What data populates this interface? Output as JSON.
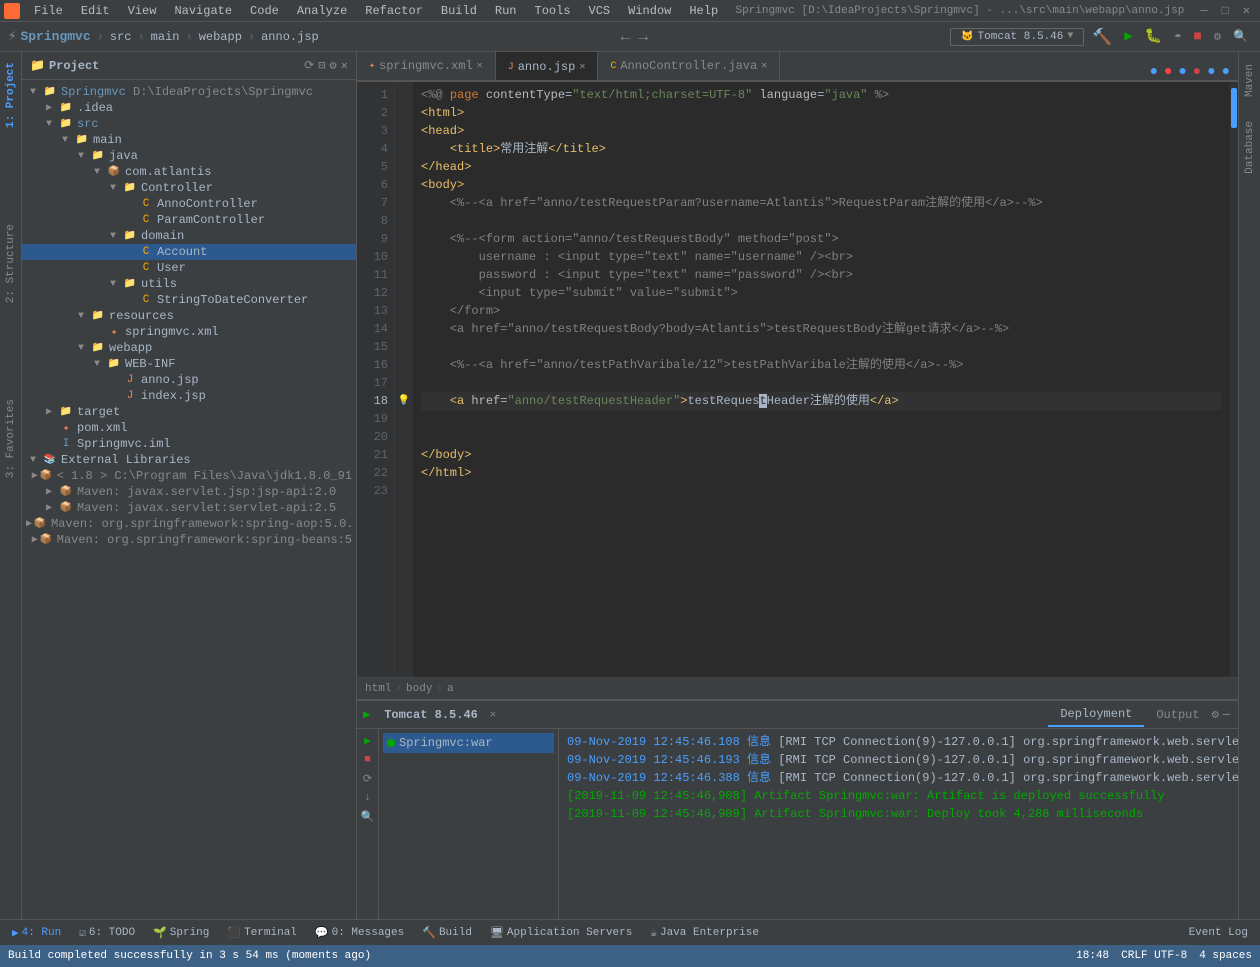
{
  "menubar": {
    "items": [
      "File",
      "Edit",
      "View",
      "Navigate",
      "Code",
      "Analyze",
      "Refactor",
      "Build",
      "Run",
      "Tools",
      "VCS",
      "Window",
      "Help"
    ]
  },
  "toolbar": {
    "project_name": "Springmvc",
    "path_parts": [
      "src",
      "main",
      "webapp",
      "anno.jsp"
    ],
    "run_config": "Tomcat 8.5.46"
  },
  "project_panel": {
    "title": "Project",
    "root": "Springmvc",
    "root_path": "D:\\IdeaProjects\\Springmvc"
  },
  "tabs": [
    {
      "label": "springmvc.xml",
      "active": false
    },
    {
      "label": "anno.jsp",
      "active": true
    },
    {
      "label": "AnnoController.java",
      "active": false
    }
  ],
  "code_lines": [
    {
      "num": 1,
      "content": "<%@ page contentType=\"text/html;charset=UTF-8\" language=\"java\" %>"
    },
    {
      "num": 2,
      "content": "<html>"
    },
    {
      "num": 3,
      "content": "<head>"
    },
    {
      "num": 4,
      "content": "    <title>常用注解</title>"
    },
    {
      "num": 5,
      "content": "</head>"
    },
    {
      "num": 6,
      "content": "<body>"
    },
    {
      "num": 7,
      "content": "    <%--<a href=\"anno/testRequestParam?username=Atlantis\">RequestParam注解的使用</a>--%>"
    },
    {
      "num": 8,
      "content": ""
    },
    {
      "num": 9,
      "content": "    <%--<form action=\"anno/testRequestBody\" method=\"post\">"
    },
    {
      "num": 10,
      "content": "        username : <input type=\"text\" name=\"username\" /><br>"
    },
    {
      "num": 11,
      "content": "        password : <input type=\"text\" name=\"password\" /><br>"
    },
    {
      "num": 12,
      "content": "        <input type=\"submit\" value=\"submit\">"
    },
    {
      "num": 13,
      "content": "    </form>"
    },
    {
      "num": 14,
      "content": "    <a href=\"anno/testRequestBody?body=Atlantis\">testRequestBody注解get请求</a>--%>"
    },
    {
      "num": 15,
      "content": ""
    },
    {
      "num": 16,
      "content": "    <%--<a href=\"anno/testPathVaribale/12\">testPathVaribale注解的使用</a>--%>"
    },
    {
      "num": 17,
      "content": ""
    },
    {
      "num": 18,
      "content": "    <a href=\"anno/testRequestHeader\">testRequestHeader注解的使用</a>"
    },
    {
      "num": 19,
      "content": ""
    },
    {
      "num": 20,
      "content": ""
    },
    {
      "num": 21,
      "content": "</body>"
    },
    {
      "num": 22,
      "content": "</html>"
    },
    {
      "num": 23,
      "content": ""
    }
  ],
  "breadcrumb": {
    "items": [
      "html",
      "body",
      "a"
    ]
  },
  "bottom_panel": {
    "title": "Tomcat 8.5.46",
    "tabs": [
      {
        "label": "Deployment",
        "active": true
      },
      {
        "label": "Output",
        "active": false
      }
    ],
    "server": "Springmvc:war",
    "log_lines": [
      {
        "text": "09-Nov-2019 12:45:46.108 信息 [RMI TCP Connection(9)-127.0.0.1] org.springframework.web.servlet.mvc.method.anno",
        "type": "info"
      },
      {
        "text": "09-Nov-2019 12:45:46.193 信息 [RMI TCP Connection(9)-127.0.0.1] org.springframework.web.servlet.mvc.method.anno",
        "type": "info"
      },
      {
        "text": "09-Nov-2019 12:45:46.388 信息 [RMI TCP Connection(9)-127.0.0.1] org.springframework.web.servlet.FrameworkServle",
        "type": "info"
      },
      {
        "text": "[2019-11-09 12:45:46,908] Artifact Springmvc:war: Artifact is deployed successfully",
        "type": "success"
      },
      {
        "text": "[2019-11-09 12:45:46,909] Artifact Springmvc:war: Deploy took 4,288 milliseconds",
        "type": "success"
      }
    ]
  },
  "statusbar": {
    "left": "Build completed successfully in 3 s 54 ms (moments ago)",
    "line_col": "18:48",
    "encoding": "CRLF  UTF-8",
    "indent": "4 spaces"
  },
  "bottom_tools": [
    {
      "label": "4: Run",
      "active": true,
      "icon": "▶"
    },
    {
      "label": "6: TODO",
      "active": false
    },
    {
      "label": "Spring",
      "active": false
    },
    {
      "label": "Terminal",
      "active": false
    },
    {
      "label": "0: Messages",
      "active": false
    },
    {
      "label": "Build",
      "active": false
    },
    {
      "label": "Application Servers",
      "active": false
    },
    {
      "label": "Java Enterprise",
      "active": false
    }
  ],
  "right_panels": [
    {
      "label": "Maven"
    },
    {
      "label": "Database"
    }
  ],
  "event_log": "Event Log"
}
